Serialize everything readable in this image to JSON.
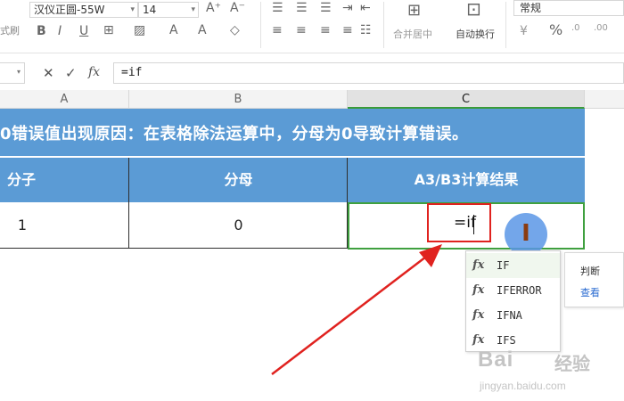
{
  "ribbon": {
    "format_brush_label": "式刷",
    "font_name": "汉仪正圆-55W",
    "font_size": "14",
    "merge_label": "合并居中",
    "wrap_label": "自动换行",
    "number_format": "常规",
    "percent_symbol": "%",
    "currency_symbol": "¥"
  },
  "formula_bar": {
    "fx_label": "fx",
    "value": "=if"
  },
  "columns": [
    "A",
    "B",
    "C"
  ],
  "sheet": {
    "title": "0错误值出现原因：在表格除法运算中，分母为0导致计算错误。",
    "headers": [
      "分子",
      "分母",
      "A3/B3计算结果"
    ],
    "row": [
      "1",
      "0",
      "=if"
    ]
  },
  "autocomplete": {
    "items": [
      "IF",
      "IFERROR",
      "IFNA",
      "IFS"
    ],
    "tooltip_desc": "判断",
    "tooltip_link": "查看"
  },
  "watermark": {
    "brand": "Bai",
    "brand_cn": "经验",
    "url": "jingyan.baidu.com"
  },
  "colors": {
    "header_blue": "#5b9bd5",
    "active_green": "#3fa03f",
    "highlight_red": "#e0221f"
  }
}
